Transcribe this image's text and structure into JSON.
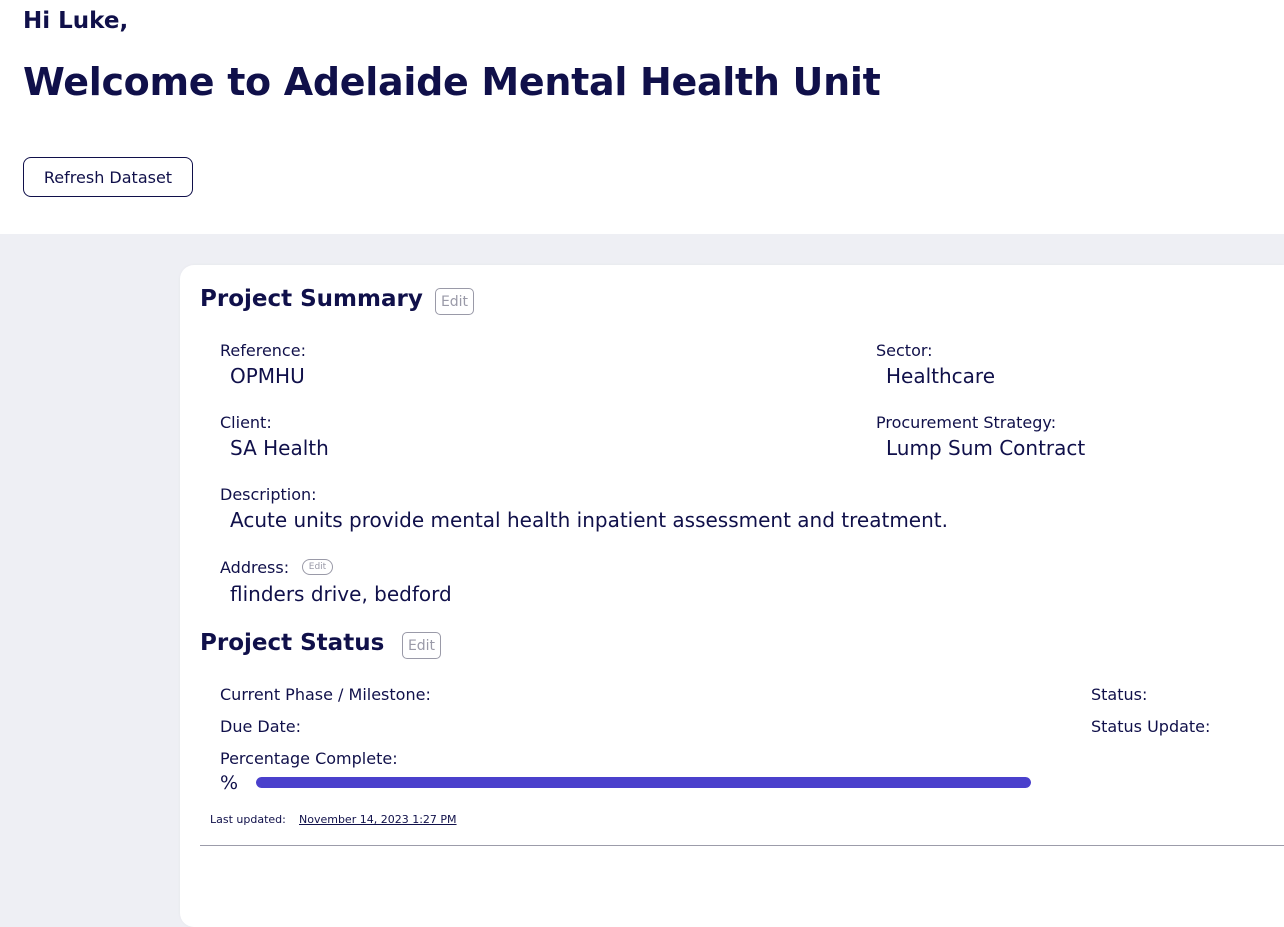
{
  "header": {
    "greeting": "Hi Luke,",
    "welcome": "Welcome to Adelaide Mental Health Unit",
    "refresh_label": "Refresh Dataset"
  },
  "project_summary": {
    "title": "Project Summary",
    "edit_label": "Edit",
    "fields": {
      "reference_label": "Reference:",
      "reference_value": "OPMHU",
      "sector_label": "Sector:",
      "sector_value": "Healthcare",
      "client_label": "Client:",
      "client_value": "SA Health",
      "procurement_label": "Procurement Strategy:",
      "procurement_value": "Lump Sum Contract",
      "description_label": "Description:",
      "description_value": "Acute units provide mental health inpatient assessment and treatment.",
      "address_label": "Address:",
      "address_edit_label": "Edit",
      "address_value": "flinders drive, bedford"
    }
  },
  "project_status": {
    "title": "Project Status",
    "edit_label": "Edit",
    "phase_label": "Current Phase / Milestone:",
    "status_label": "Status:",
    "due_date_label": "Due Date:",
    "status_update_label": "Status Update:",
    "percentage_label": "Percentage Complete:",
    "percent_sign": "%",
    "progress_fraction": 1.0,
    "last_updated_label": "Last updated:",
    "last_updated_value": "November 14, 2023 1:27 PM"
  },
  "colors": {
    "text": "#10104a",
    "accent": "#4a40cc",
    "background_gray": "#eeeff4",
    "muted": "#9a9aa8"
  }
}
